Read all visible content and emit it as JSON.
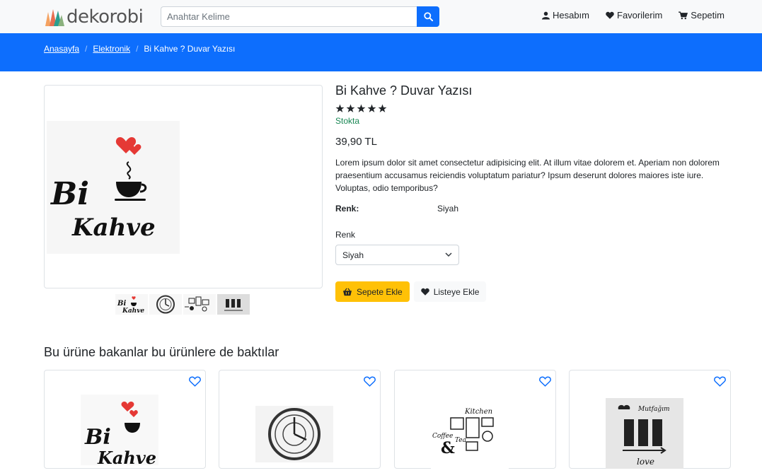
{
  "header": {
    "logo_text": "dekorobi",
    "search_placeholder": "Anahtar Kelime",
    "links": [
      {
        "label": "Hesabım",
        "icon": "user-icon"
      },
      {
        "label": "Favorilerim",
        "icon": "heart-icon"
      },
      {
        "label": "Sepetim",
        "icon": "cart-icon"
      }
    ]
  },
  "breadcrumb": [
    "Anasayfa",
    "Elektronik",
    "Bi Kahve ? Duvar Yazısı"
  ],
  "product": {
    "title": "Bi Kahve ? Duvar Yazısı",
    "rating": 5,
    "stock": "Stokta",
    "price": "39,90 TL",
    "description": "Lorem ipsum dolor sit amet consectetur adipisicing elit. At illum vitae dolorem et. Aperiam non dolorem praesentium accusamus reiciendis voluptatum pariatur? Ipsum deserunt dolores maiores iste iure. Voluptas, odio temporibus?",
    "spec_label": "Renk:",
    "spec_value": "Siyah",
    "option_label": "Renk",
    "option_selected": "Siyah",
    "image_text_1": "Bi",
    "image_text_2": "Kahve",
    "add_to_cart": "Sepete Ekle",
    "add_to_list": "Listeye Ekle"
  },
  "related": {
    "title": "Bu ürüne bakanlar bu ürünlere de baktılar",
    "card1_text_1": "Bi",
    "card1_text_2": "Kahve",
    "card3_text_1": "Kitchen",
    "card3_text_2": "Coffee",
    "card3_text_3": "Tea",
    "card4_text_1": "Mutfağım",
    "card4_text_2": "love"
  },
  "colors": {
    "primary": "#0d6efd",
    "warning": "#ffc107",
    "success": "#198754"
  }
}
